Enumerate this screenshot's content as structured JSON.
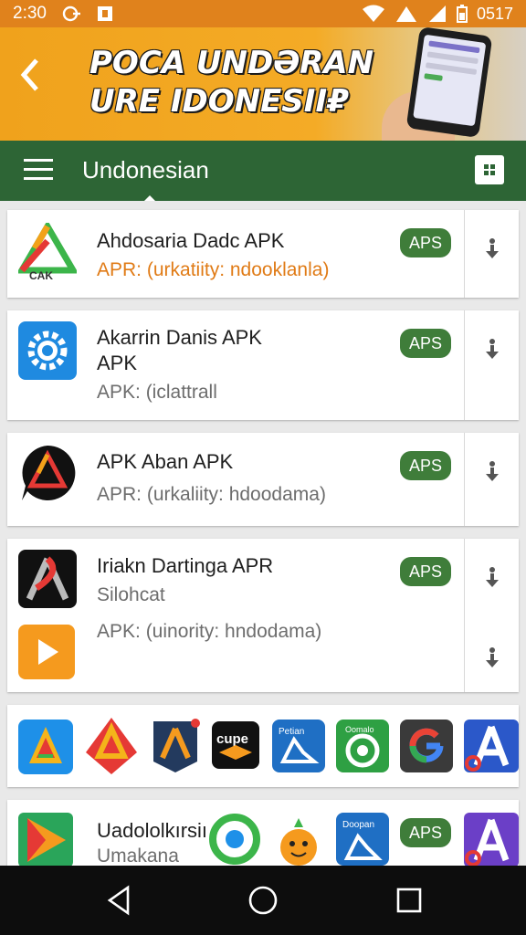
{
  "status_bar": {
    "time": "2:30",
    "clock_right": "0517"
  },
  "banner": {
    "title_line1": "POCA UNDӘRAN",
    "title_line2": "URE IDONESII₽"
  },
  "toolbar": {
    "title": "Undonesian"
  },
  "apps": [
    {
      "name": "Ahdosaria Dadc APK",
      "subtitle": "APR: (urkatiity: ndooklanla)",
      "badge": "APS",
      "icon_label": "CAK"
    },
    {
      "name": "Akarrin Danis APK",
      "name2": "APK",
      "subtitle": "APK: (iclattrall",
      "badge": "APS"
    },
    {
      "name": "APK Aban APK",
      "subtitle": "APR: (urkaliity: hdoodama)",
      "badge": "APS"
    },
    {
      "name": "Iriakn Dartinga APR",
      "subtitle": "Silohcat",
      "subtitle2": "APK: (uinority: hndodama)",
      "badge": "APS"
    }
  ],
  "icon_row": {
    "icon2_label": "cupe",
    "icon5_label": "Petian",
    "icon6_label": "Oomalo"
  },
  "last_app": {
    "name": "Uadololkırsiı",
    "subtitle": "Umakana",
    "badge": "APS",
    "icon_label": "Doopan"
  },
  "colors": {
    "status": "#e0821c",
    "banner": "#f4ab26",
    "toolbar": "#2d6535",
    "badge": "#3f7d3a",
    "orange_text": "#e07b16"
  }
}
